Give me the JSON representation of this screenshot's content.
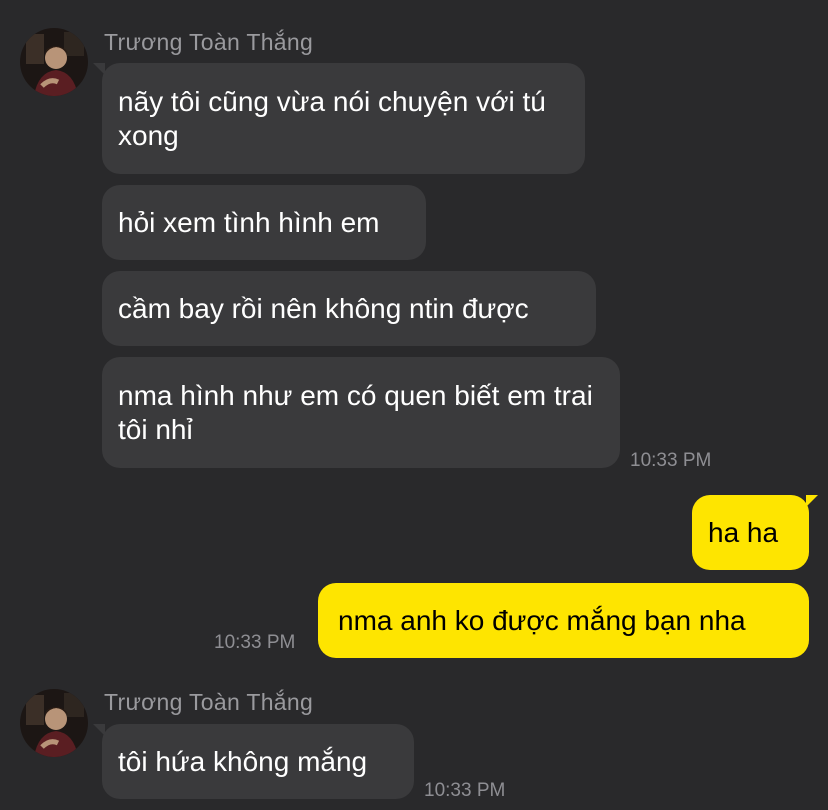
{
  "chat": {
    "groups": [
      {
        "sender": "Trương Toàn Thắng",
        "messages": [
          "nãy tôi cũng vừa nói chuyện với tú xong",
          "hỏi xem tình hình em",
          "cầm bay rồi nên không ntin được",
          "nma hình như em có quen biết em trai tôi nhỉ"
        ],
        "time": "10:33 PM"
      },
      {
        "sender": "me",
        "messages": [
          "ha ha",
          "nma anh ko được mắng bạn nha"
        ],
        "time": "10:33 PM"
      },
      {
        "sender": "Trương Toàn Thắng",
        "messages": [
          "tôi hứa không mắng"
        ],
        "time": "10:33 PM"
      }
    ]
  },
  "colors": {
    "background": "#29292b",
    "incoming_bubble": "#3a3a3c",
    "outgoing_bubble": "#fee500",
    "timestamp": "#8e8e93"
  },
  "icons": {
    "avatar": "contact-avatar-icon"
  }
}
